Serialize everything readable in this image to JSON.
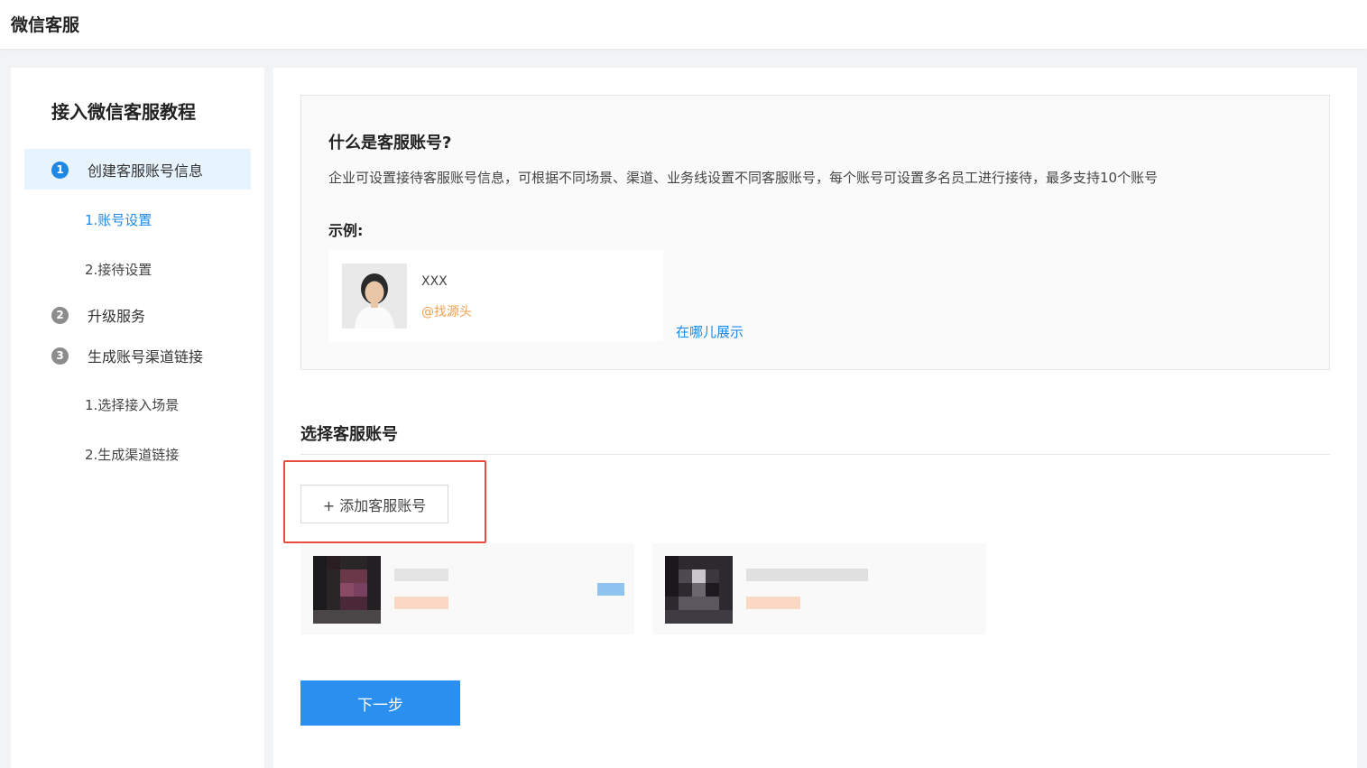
{
  "app": {
    "title": "微信客服"
  },
  "sidebar": {
    "title": "接入微信客服教程",
    "steps": [
      {
        "num": "1",
        "label": "创建客服账号信息",
        "active": true
      },
      {
        "num": "2",
        "label": "升级服务"
      },
      {
        "num": "3",
        "label": "生成账号渠道链接"
      }
    ],
    "substeps_step1": [
      "1.账号设置",
      "2.接待设置"
    ],
    "substeps_step3": [
      "1.选择接入场景",
      "2.生成渠道链接"
    ]
  },
  "info": {
    "question": "什么是客服账号?",
    "description": "企业可设置接待客服账号信息，可根据不同场景、渠道、业务线设置不同客服账号，每个账号可设置多名员工进行接待，最多支持10个账号",
    "example_label": "示例:",
    "example_name": "XXX",
    "example_handle": "@找源头",
    "where_link": "在哪儿展示"
  },
  "accounts_section": {
    "title": "选择客服账号",
    "add_button": "+ 添加客服账号"
  },
  "next_button": "下一步",
  "colors": {
    "accent": "#1e88e5",
    "highlight": "#e84c3d",
    "primary_button": "#2b8ff0",
    "handle": "#f0a050"
  }
}
